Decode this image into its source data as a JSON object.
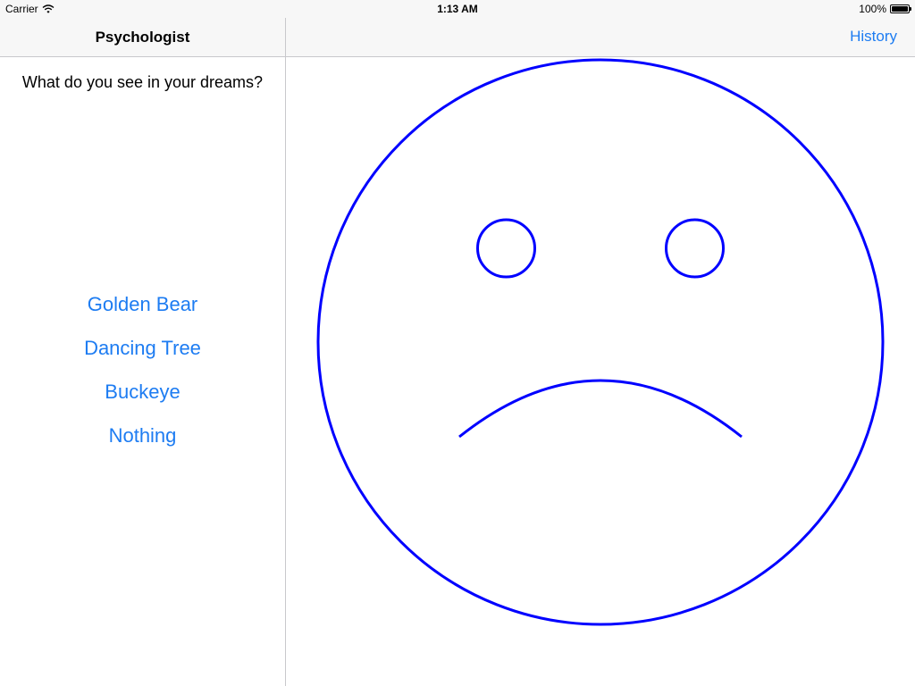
{
  "status_bar": {
    "carrier": "Carrier",
    "time": "1:13 AM",
    "battery": "100%",
    "wifi_icon": "wifi-icon",
    "battery_icon": "battery-icon"
  },
  "master": {
    "title": "Psychologist",
    "question": "What do you see in your dreams?",
    "answers": [
      "Golden Bear",
      "Dancing Tree",
      "Buckeye",
      "Nothing"
    ],
    "answer_color": "#1d7cf2"
  },
  "detail": {
    "history_label": "History",
    "face": {
      "expression": "sad",
      "happiness": -1,
      "stroke_color": "#0000ff"
    }
  }
}
